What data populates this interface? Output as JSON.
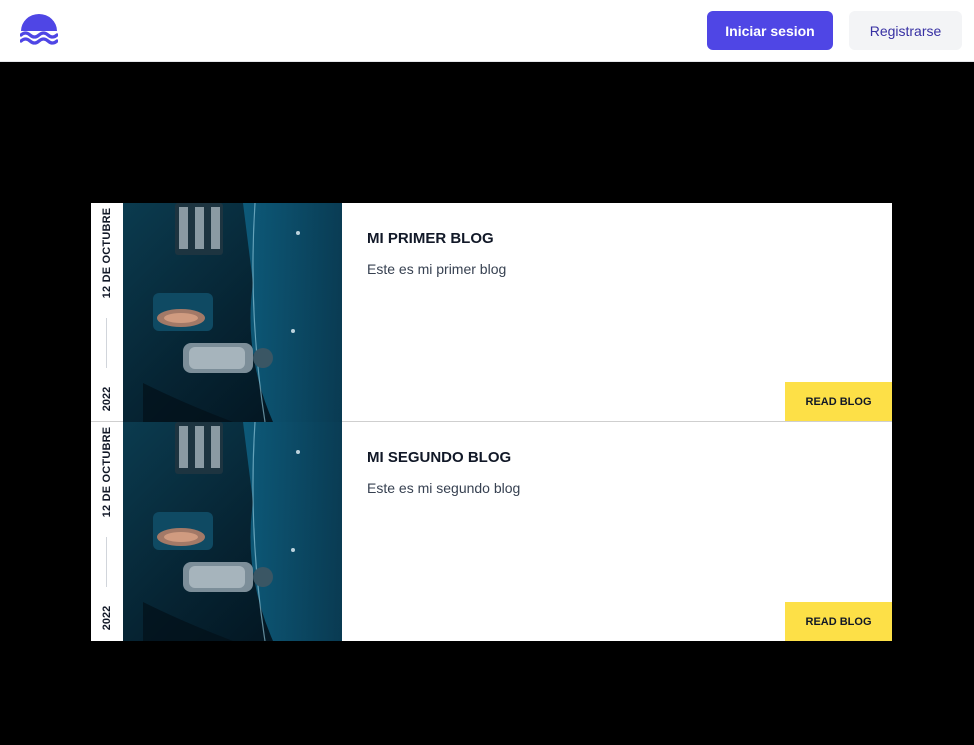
{
  "header": {
    "logo_icon": "wave-logo-icon",
    "login_label": "Iniciar sesion",
    "register_label": "Registrarse",
    "accent_color": "#4f46e5"
  },
  "blogs": [
    {
      "date_day": "12 DE OCTUBRE",
      "date_year": "2022",
      "title": "MI PRIMER BLOG",
      "excerpt": "Este es mi primer blog",
      "read_label": "READ BLOG"
    },
    {
      "date_day": "12 DE OCTUBRE",
      "date_year": "2022",
      "title": "MI SEGUNDO BLOG",
      "excerpt": "Este es mi segundo blog",
      "read_label": "READ BLOG"
    }
  ],
  "colors": {
    "read_button": "#fde047",
    "page_background": "#000000"
  }
}
